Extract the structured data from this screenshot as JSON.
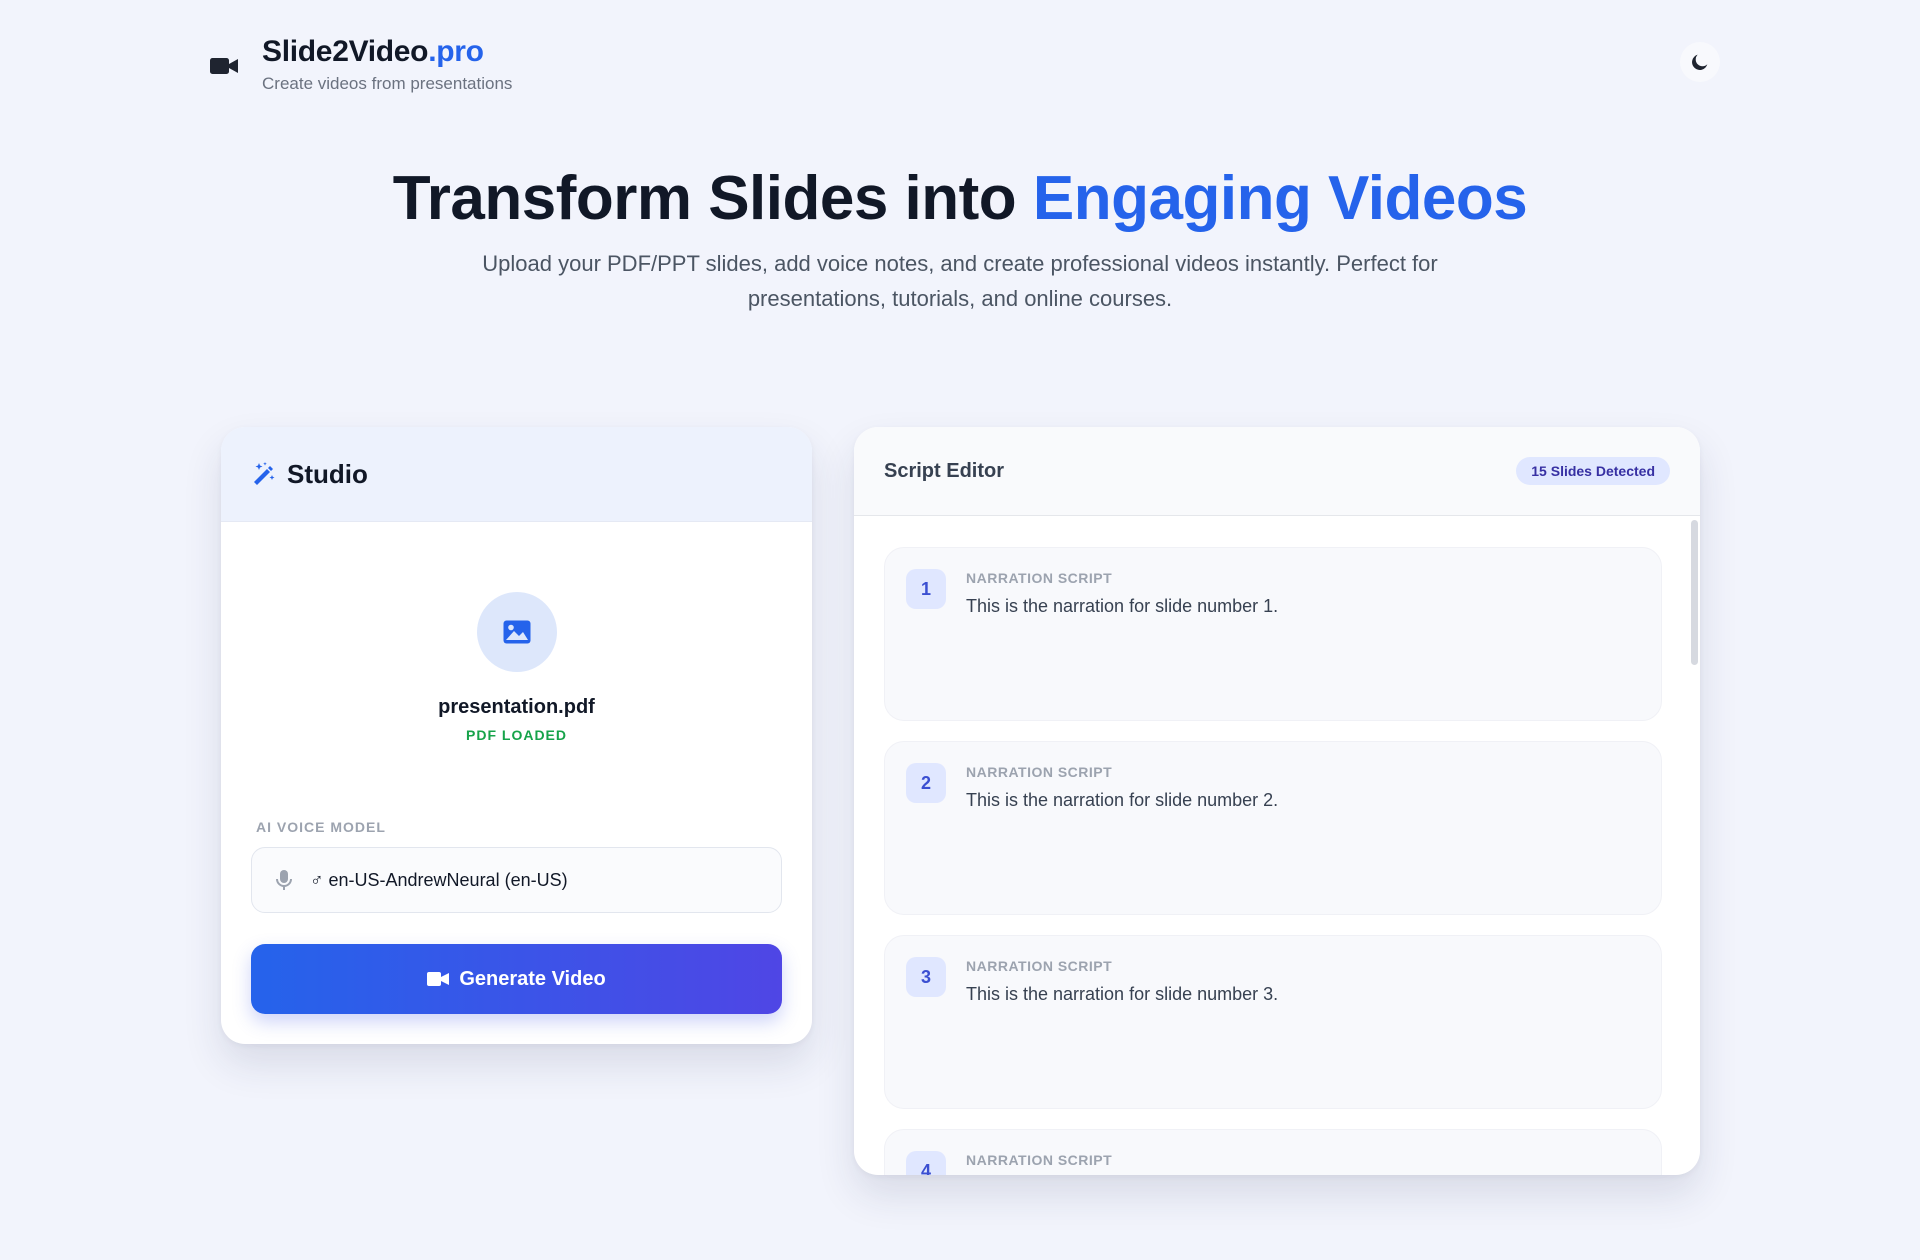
{
  "header": {
    "brand_main": "Slide2Video",
    "brand_accent": ".pro",
    "subtitle": "Create videos from presentations",
    "logo_icon": "video-camera-icon",
    "theme_icon": "moon-icon"
  },
  "hero": {
    "title_main": "Transform Slides into ",
    "title_accent": "Engaging Videos",
    "description": "Upload your PDF/PPT slides, add voice notes, and create professional videos instantly. Perfect for presentations, tutorials, and online courses."
  },
  "studio": {
    "title": "Studio",
    "title_icon": "magic-wand-icon",
    "file_icon": "image-icon",
    "file_name": "presentation.pdf",
    "file_status": "PDF LOADED",
    "voice_label": "AI VOICE MODEL",
    "voice_icon": "microphone-icon",
    "voice_value": "♂ en-US-AndrewNeural (en-US)",
    "generate_label": "Generate Video",
    "generate_icon": "video-camera-icon"
  },
  "editor": {
    "title": "Script Editor",
    "badge": "15 Slides Detected",
    "slides": [
      {
        "number": "1",
        "label": "NARRATION SCRIPT",
        "text": "This is the narration for slide number 1."
      },
      {
        "number": "2",
        "label": "NARRATION SCRIPT",
        "text": "This is the narration for slide number 2."
      },
      {
        "number": "3",
        "label": "NARRATION SCRIPT",
        "text": "This is the narration for slide number 3."
      },
      {
        "number": "4",
        "label": "NARRATION SCRIPT",
        "text": ""
      }
    ]
  },
  "colors": {
    "accent": "#2563eb",
    "success": "#16a34a",
    "gradient_end": "#4f46e5",
    "background": "#f2f4fc"
  }
}
